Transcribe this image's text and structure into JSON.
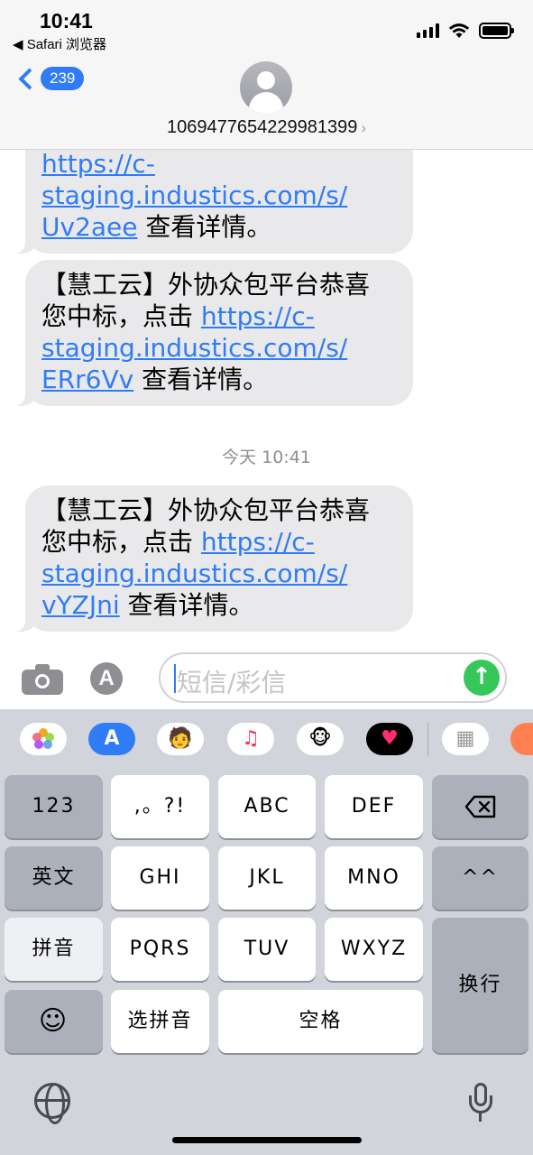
{
  "status_bar": {
    "time": "10:41",
    "back_app": "◀ Safari 浏览器"
  },
  "header": {
    "back_count": "239",
    "contact": "1069477654229981399"
  },
  "messages": [
    {
      "id": "msg-partial",
      "link": "https://c-staging.industics.com/s/Uv2aee",
      "link_parts": [
        "https://c-",
        "staging.industics.com/s/",
        "Uv2aee"
      ],
      "suffix": " 查看详情。"
    },
    {
      "id": "msg-2",
      "prefix": "【慧工云】外协众包平台恭喜您中标，点击 ",
      "link": "https://c-staging.industics.com/s/ERr6Vv",
      "link_parts": [
        "https://c-",
        "staging.industics.com/s/",
        "ERr6Vv"
      ],
      "suffix": " 查看详情。"
    },
    {
      "id": "msg-3",
      "prefix": "【慧工云】外协众包平台恭喜您中标，点击 ",
      "link": "https://c-staging.industics.com/s/vYZJni",
      "link_parts": [
        "https://c-",
        "staging.industics.com/s/",
        "vYZJni"
      ],
      "suffix": " 查看详情。"
    }
  ],
  "timestamp": "今天 10:41",
  "composer": {
    "placeholder": "短信/彩信",
    "send_icon": "arrow-up-icon"
  },
  "keyboard": {
    "row1": [
      "123",
      ",。?!",
      "ABC",
      "DEF"
    ],
    "row2": [
      "英文",
      "GHI",
      "JKL",
      "MNO",
      "^^"
    ],
    "row3": [
      "拼音",
      "PQRS",
      "TUV",
      "WXYZ"
    ],
    "row4": [
      "选拼音",
      "空格"
    ],
    "return": "换行",
    "delete_icon": "backspace-icon",
    "emoji_icon": "emoji-icon"
  },
  "colors": {
    "accent": "#2f7cf6",
    "send": "#35c759",
    "bubble": "#e9e9eb",
    "keyboard_bg": "#d1d4da"
  }
}
